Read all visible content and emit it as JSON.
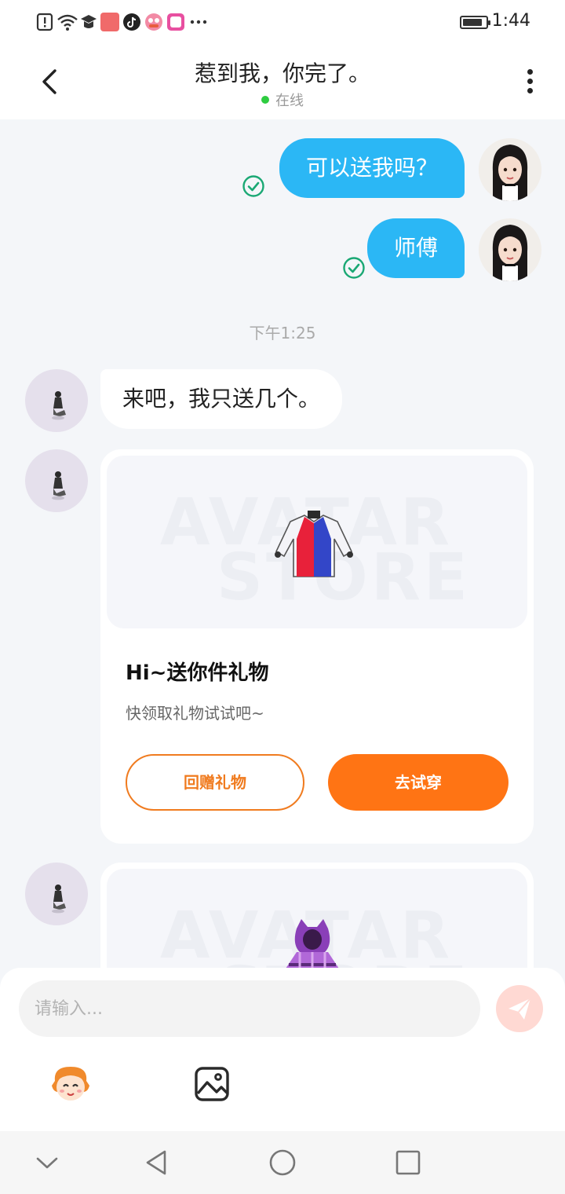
{
  "status_bar": {
    "time": "1:44",
    "battery_level": 0.85,
    "icons": [
      "alert-icon",
      "wifi-icon",
      "graduation-cap-icon",
      "shopping-app-icon",
      "tiktok-icon",
      "cartoon-app-icon",
      "square-app-icon",
      "more-dots-icon"
    ]
  },
  "header": {
    "title": "惹到我，你完了。",
    "status": "在线",
    "online_color": "#2ecc40"
  },
  "messages": {
    "out_1": "可以送我吗？",
    "out_2": "师傅",
    "time_separator": "下午1:25",
    "in_1": "来吧，我只送几个。"
  },
  "gift_card": {
    "watermark_top": "AVATAR",
    "watermark_bottom": "STORE",
    "title": "Hi~送你件礼物",
    "subtitle": "快领取礼物试试吧~",
    "return_gift_label": "回赠礼物",
    "try_on_label": "去试穿"
  },
  "gift_card_2": {
    "watermark_top": "AVATAR",
    "watermark_bottom": "STORE"
  },
  "input": {
    "placeholder": "请输入..."
  },
  "colors": {
    "accent_blue": "#2bb7f5",
    "accent_orange": "#ff7414",
    "check_green": "#1aa874"
  }
}
